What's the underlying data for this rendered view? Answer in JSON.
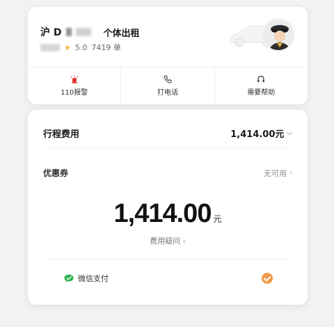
{
  "driver": {
    "plate_prefix": "沪 D",
    "car_type": "个体出租",
    "rating": "5.0",
    "orders": "7419 单"
  },
  "actions": [
    {
      "label": "110报警",
      "icon": "alarm-icon",
      "color": "#e2302d"
    },
    {
      "label": "打电话",
      "icon": "phone-icon"
    },
    {
      "label": "需要帮助",
      "icon": "headset-icon"
    }
  ],
  "fare": {
    "trip_label": "行程费用",
    "trip_amount": "1,414.00元",
    "coupon_label": "优惠券",
    "coupon_value": "无可用",
    "total": "1,414.00",
    "unit": "元",
    "question": "费用疑问"
  },
  "payment": {
    "method": "微信支付",
    "wechat_color": "#2bb14a",
    "selected_color": "#f39a4b"
  }
}
